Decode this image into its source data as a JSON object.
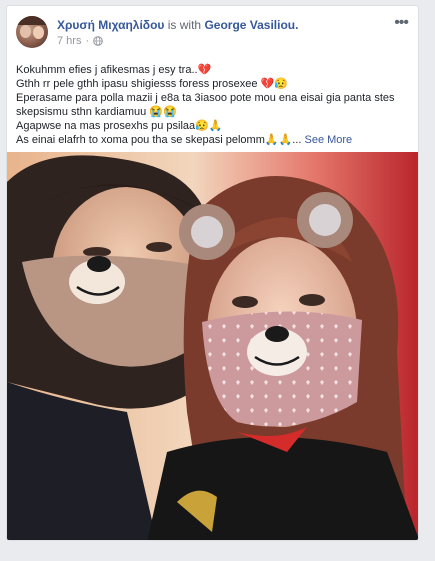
{
  "post": {
    "author": "Χρυσή Μιχαηλίδου",
    "with_text": "is with",
    "tagged": "George Vasiliou.",
    "time": "7 hrs",
    "privacy_icon": "globe-icon",
    "more_icon": "ellipsis-icon",
    "lines": [
      "Kokuhmm efies j afikesmas j esy tra..💔",
      "Gthh rr pele gthh ipasu shigiesss foress prosexee 💔😥",
      "Eperasame para polla mazii j e8a ta 3iasoo pote mou ena eisai gia panta stes skepsismu sthn kardiamuu 😭😭",
      "Agapwse na mas prosexhs pu psilaa😥🙏",
      "As einai elafrh to xoma pou tha se skepasi pelomm🙏🙏..."
    ],
    "see_more": "See More"
  },
  "colors": {
    "link": "#365899",
    "page_bg": "#e9ebee",
    "card_bg": "#ffffff"
  }
}
